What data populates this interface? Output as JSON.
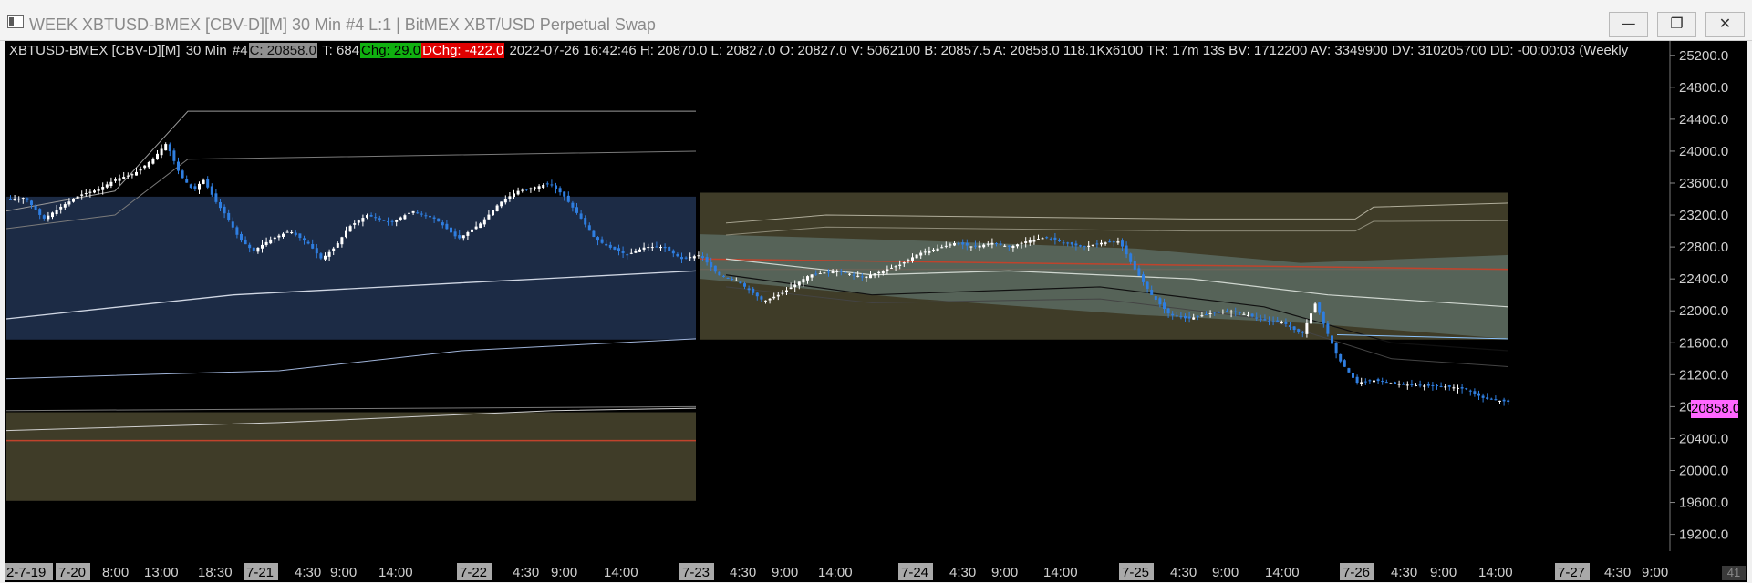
{
  "window": {
    "title": "WEEK XBTUSD-BMEX [CBV-D][M]  30 Min   #4 L:1 | BitMEX XBT/USD Perpetual Swap",
    "controls": {
      "minimize": "—",
      "maximize": "❐",
      "close": "✕"
    }
  },
  "info": {
    "symbol": "XBTUSD-BMEX [CBV-D][M]",
    "interval": "30 Min",
    "chart_no": "#4",
    "close": "C: 20858.0",
    "ticks": "T: 684",
    "chg": "Chg: 29.0",
    "dchg": "DChg: -422.0",
    "rest": "2022-07-26 16:42:46 H: 20870.0 L: 20827.0 O: 20827.0 V: 5062100 B: 20857.5 A: 20858.0 118.1Kx6100 TR: 17m 13s BV: 1712200 AV: 3349900 DV: 310205700 DD: -00:00:03  (Weekly"
  },
  "price_flag": "20858.0",
  "corner_value": "41",
  "colors": {
    "background": "#000000",
    "bull": "#ffffff",
    "bear": "#2f7ee0",
    "value_area_prev": "#1c2b45",
    "value_area_olive": "#3f3c28",
    "value_area_grey": "#5a6a60",
    "poc_line": "#c0432c",
    "price_flag": "#ff66ff"
  },
  "chart_data": {
    "type": "candlestick",
    "interval": "30 Min",
    "y_ticks": [
      25200,
      24800,
      24400,
      24000,
      23600,
      23200,
      22800,
      22400,
      22000,
      21600,
      21200,
      20800,
      20400,
      20000,
      19600,
      19200
    ],
    "ylim": [
      18990,
      25380
    ],
    "x_labels": [
      {
        "text": "2-7-19",
        "date": true
      },
      {
        "text": "7-20",
        "date": true
      },
      {
        "text": "8:00"
      },
      {
        "text": "13:00"
      },
      {
        "text": "18:30"
      },
      {
        "text": "7-21",
        "date": true
      },
      {
        "text": "4:30"
      },
      {
        "text": "9:00"
      },
      {
        "text": "14:00"
      },
      {
        "text": "7-22",
        "date": true
      },
      {
        "text": "4:30"
      },
      {
        "text": "9:00"
      },
      {
        "text": "14:00"
      },
      {
        "text": "7-23",
        "date": true
      },
      {
        "text": "4:30"
      },
      {
        "text": "9:00"
      },
      {
        "text": "14:00"
      },
      {
        "text": "7-24",
        "date": true
      },
      {
        "text": "4:30"
      },
      {
        "text": "9:00"
      },
      {
        "text": "14:00"
      },
      {
        "text": "7-25",
        "date": true
      },
      {
        "text": "4:30"
      },
      {
        "text": "9:00"
      },
      {
        "text": "14:00"
      },
      {
        "text": "7-26",
        "date": true
      },
      {
        "text": "4:30"
      },
      {
        "text": "9:00"
      },
      {
        "text": "14:00"
      },
      {
        "text": "7-27",
        "date": true
      },
      {
        "text": "4:30"
      },
      {
        "text": "9:00"
      }
    ],
    "last_price": 20858.0,
    "weekly_profiles": [
      {
        "value_area": [
          21640,
          23430
        ],
        "extension": [
          19620,
          20730
        ],
        "poc": 20375
      },
      {
        "value_area": [
          21640,
          23480
        ],
        "poc": 22520
      }
    ],
    "price_path": [
      [
        0,
        23380
      ],
      [
        20,
        23420
      ],
      [
        40,
        23150
      ],
      [
        60,
        23310
      ],
      [
        80,
        23450
      ],
      [
        100,
        23520
      ],
      [
        120,
        23650
      ],
      [
        140,
        23720
      ],
      [
        160,
        23900
      ],
      [
        175,
        24100
      ],
      [
        190,
        23700
      ],
      [
        205,
        23500
      ],
      [
        215,
        23650
      ],
      [
        230,
        23350
      ],
      [
        240,
        23200
      ],
      [
        255,
        22900
      ],
      [
        270,
        22750
      ],
      [
        290,
        22900
      ],
      [
        310,
        23000
      ],
      [
        330,
        22850
      ],
      [
        345,
        22650
      ],
      [
        360,
        22800
      ],
      [
        375,
        23050
      ],
      [
        395,
        23200
      ],
      [
        420,
        23100
      ],
      [
        445,
        23250
      ],
      [
        470,
        23150
      ],
      [
        495,
        22900
      ],
      [
        520,
        23100
      ],
      [
        540,
        23350
      ],
      [
        560,
        23500
      ],
      [
        580,
        23550
      ],
      [
        595,
        23600
      ],
      [
        610,
        23450
      ],
      [
        630,
        23150
      ],
      [
        645,
        22900
      ],
      [
        660,
        22800
      ],
      [
        680,
        22700
      ],
      [
        700,
        22800
      ],
      [
        720,
        22800
      ],
      [
        740,
        22650
      ],
      [
        760,
        22700
      ],
      [
        780,
        22450
      ],
      [
        800,
        22380
      ],
      [
        830,
        22120
      ],
      [
        850,
        22220
      ],
      [
        880,
        22450
      ],
      [
        910,
        22500
      ],
      [
        940,
        22420
      ],
      [
        960,
        22500
      ],
      [
        980,
        22580
      ],
      [
        1000,
        22720
      ],
      [
        1020,
        22780
      ],
      [
        1040,
        22850
      ],
      [
        1060,
        22800
      ],
      [
        1080,
        22850
      ],
      [
        1100,
        22800
      ],
      [
        1120,
        22880
      ],
      [
        1140,
        22920
      ],
      [
        1160,
        22850
      ],
      [
        1180,
        22800
      ],
      [
        1200,
        22850
      ],
      [
        1220,
        22870
      ],
      [
        1235,
        22550
      ],
      [
        1255,
        22200
      ],
      [
        1275,
        21950
      ],
      [
        1295,
        21900
      ],
      [
        1320,
        21970
      ],
      [
        1340,
        22000
      ],
      [
        1360,
        21950
      ],
      [
        1380,
        21880
      ],
      [
        1400,
        21850
      ],
      [
        1420,
        21700
      ],
      [
        1435,
        22100
      ],
      [
        1445,
        21800
      ],
      [
        1460,
        21400
      ],
      [
        1480,
        21100
      ],
      [
        1500,
        21130
      ],
      [
        1520,
        21090
      ],
      [
        1540,
        21070
      ],
      [
        1560,
        21060
      ],
      [
        1580,
        21050
      ],
      [
        1600,
        21020
      ],
      [
        1620,
        20900
      ],
      [
        1640,
        20870
      ],
      [
        1648,
        20858
      ]
    ]
  }
}
